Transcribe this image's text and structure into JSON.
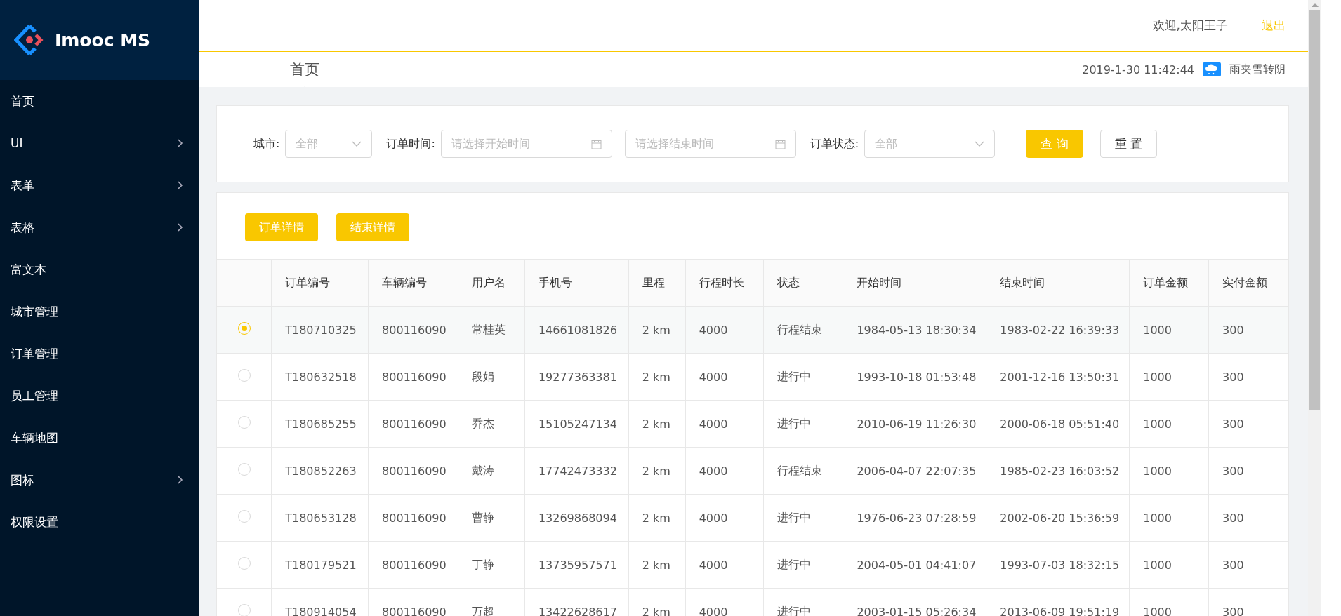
{
  "sidebar": {
    "logo": "Imooc MS",
    "items": [
      {
        "label": "首页",
        "expandable": false
      },
      {
        "label": "UI",
        "expandable": true
      },
      {
        "label": "表单",
        "expandable": true
      },
      {
        "label": "表格",
        "expandable": true
      },
      {
        "label": "富文本",
        "expandable": false
      },
      {
        "label": "城市管理",
        "expandable": false
      },
      {
        "label": "订单管理",
        "expandable": false
      },
      {
        "label": "员工管理",
        "expandable": false
      },
      {
        "label": "车辆地图",
        "expandable": false
      },
      {
        "label": "图标",
        "expandable": true
      },
      {
        "label": "权限设置",
        "expandable": false
      }
    ]
  },
  "header": {
    "welcome": "欢迎,太阳王子",
    "logout": "退出",
    "breadcrumb": "首页",
    "datetime": "2019-1-30 11:42:44",
    "weather": "雨夹雪转阴"
  },
  "filters": {
    "fields": [
      {
        "label": "城市:",
        "kind": "select",
        "value": "全部"
      },
      {
        "label": "订单时间:",
        "kind": "date",
        "placeholder": "请选择开始时间"
      },
      {
        "kind": "date",
        "placeholder": "请选择结束时间"
      },
      {
        "label": "订单状态:",
        "kind": "select",
        "value": "全部"
      }
    ],
    "buttons": [
      {
        "label": "查 询",
        "primary": true
      },
      {
        "label": "重 置",
        "primary": false
      }
    ]
  },
  "actions": [
    "订单详情",
    "结束详情"
  ],
  "table": {
    "columns": [
      "订单编号",
      "车辆编号",
      "用户名",
      "手机号",
      "里程",
      "行程时长",
      "状态",
      "开始时间",
      "结束时间",
      "订单金额",
      "实付金额"
    ],
    "rows": [
      {
        "selected": true,
        "cells": [
          "T180710325",
          "800116090",
          "常桂英",
          "14661081826",
          "2 km",
          "4000",
          "行程结束",
          "1984-05-13 18:30:34",
          "1983-02-22 16:39:33",
          "1000",
          "300"
        ]
      },
      {
        "selected": false,
        "cells": [
          "T180632518",
          "800116090",
          "段娟",
          "19277363381",
          "2 km",
          "4000",
          "进行中",
          "1993-10-18 01:53:48",
          "2001-12-16 13:50:31",
          "1000",
          "300"
        ]
      },
      {
        "selected": false,
        "cells": [
          "T180685255",
          "800116090",
          "乔杰",
          "15105247134",
          "2 km",
          "4000",
          "进行中",
          "2010-06-19 11:26:30",
          "2000-06-18 05:51:40",
          "1000",
          "300"
        ]
      },
      {
        "selected": false,
        "cells": [
          "T180852263",
          "800116090",
          "戴涛",
          "17742473332",
          "2 km",
          "4000",
          "行程结束",
          "2006-04-07 22:07:35",
          "1985-02-23 16:03:52",
          "1000",
          "300"
        ]
      },
      {
        "selected": false,
        "cells": [
          "T180653128",
          "800116090",
          "曹静",
          "13269868094",
          "2 km",
          "4000",
          "进行中",
          "1976-06-23 07:28:59",
          "2002-06-20 15:36:59",
          "1000",
          "300"
        ]
      },
      {
        "selected": false,
        "cells": [
          "T180179521",
          "800116090",
          "丁静",
          "13735957571",
          "2 km",
          "4000",
          "进行中",
          "2004-05-01 04:41:07",
          "1993-07-03 18:32:15",
          "1000",
          "300"
        ]
      },
      {
        "selected": false,
        "cells": [
          "T180914054",
          "800116090",
          "万超",
          "13422628617",
          "2 km",
          "4000",
          "进行中",
          "2003-01-15 05:26:34",
          "2013-06-09 19:51:19",
          "1000",
          "300"
        ]
      }
    ]
  }
}
